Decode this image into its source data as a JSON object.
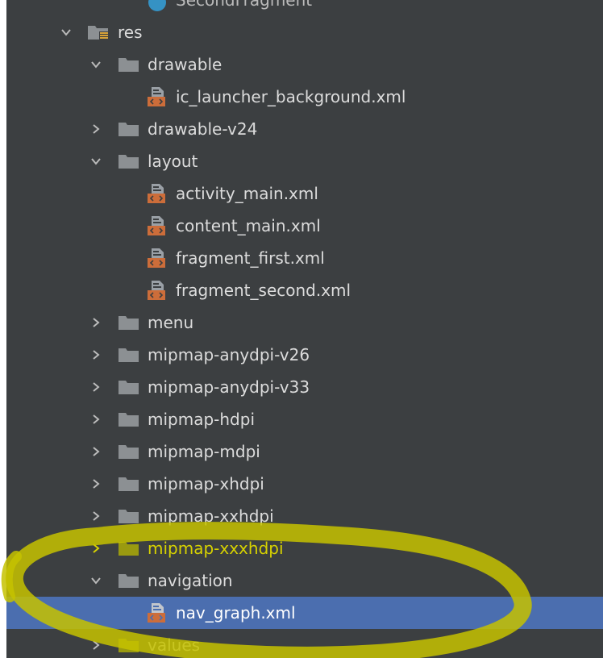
{
  "colors": {
    "panel_bg": "#3c3f41",
    "folder": "#8c9093",
    "xml_badge": "#cc6d3a",
    "selection": "#4b6eaf",
    "annotation": "#d7d200"
  },
  "tree": {
    "partial_top": "SecondFragment",
    "res": "res",
    "drawable": "drawable",
    "ic_launcher_background": "ic_launcher_background.xml",
    "drawable_v24": "drawable-v24",
    "layout": "layout",
    "activity_main": "activity_main.xml",
    "content_main": "content_main.xml",
    "fragment_first": "fragment_first.xml",
    "fragment_second": "fragment_second.xml",
    "menu": "menu",
    "mipmap_anydpi_v26": "mipmap-anydpi-v26",
    "mipmap_anydpi_v33": "mipmap-anydpi-v33",
    "mipmap_hdpi": "mipmap-hdpi",
    "mipmap_mdpi": "mipmap-mdpi",
    "mipmap_xhdpi": "mipmap-xhdpi",
    "mipmap_xxhdpi": "mipmap-xxhdpi",
    "mipmap_xxxhdpi": "mipmap-xxxhdpi",
    "navigation": "navigation",
    "nav_graph": "nav_graph.xml",
    "values": "values"
  },
  "icons": {
    "expanded": "chevron-down-icon",
    "collapsed": "chevron-right-icon",
    "folder": "folder-icon",
    "resource_folder": "resource-folder-icon",
    "xml_file": "xml-file-icon",
    "class_file": "class-icon"
  }
}
